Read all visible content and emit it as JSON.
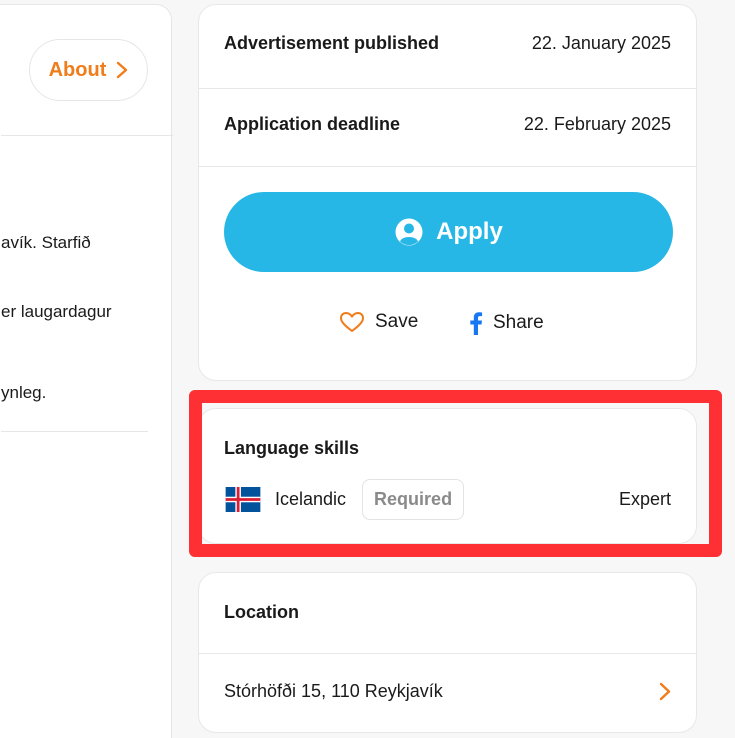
{
  "left_panel": {
    "about_label": "About",
    "text_lines": [
      "avík. Starfið",
      "er laugardagur",
      "ynleg."
    ]
  },
  "job_info": {
    "published_label": "Advertisement published",
    "published_value": "22. January 2025",
    "deadline_label": "Application deadline",
    "deadline_value": "22. February 2025"
  },
  "actions": {
    "apply_label": "Apply",
    "save_label": "Save",
    "share_label": "Share"
  },
  "language_skills": {
    "title": "Language skills",
    "language": "Icelandic",
    "requirement": "Required",
    "level": "Expert",
    "flag_icon": "iceland-flag-icon"
  },
  "location": {
    "title": "Location",
    "address": "Stórhöfði 15, 110 Reykjavík"
  },
  "colors": {
    "accent_orange": "#f07c1a",
    "apply_blue": "#27b7e6",
    "facebook_blue": "#1877f2",
    "highlight_red": "#ff3033"
  }
}
